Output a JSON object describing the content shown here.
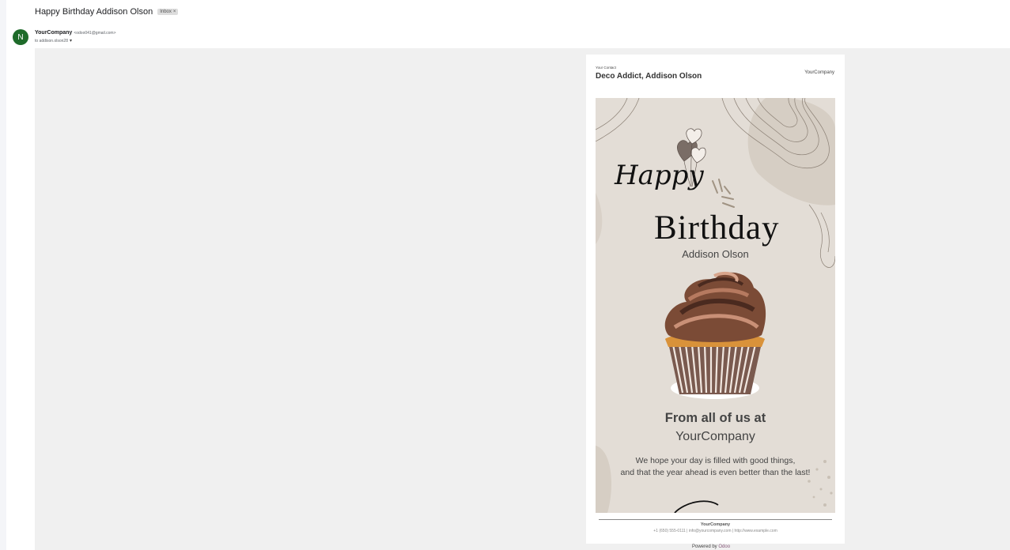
{
  "email": {
    "subject": "Happy Birthday Addison Olson",
    "label": "Inbox",
    "label_remove_glyph": "×",
    "sender_initial": "N",
    "sender_name": "YourCompany",
    "sender_email": "<odoo041@gmail.com>",
    "to_line": "to addison.olson28",
    "to_caret": "▾"
  },
  "card": {
    "contact_label": "Your Contact",
    "contact_name": "Deco Addict, Addison Olson",
    "company_right": "YourCompany",
    "banner": {
      "happy": "Happy",
      "birthday": "Birthday",
      "person": "Addison Olson",
      "from": "From all of us at",
      "company": "YourCompany",
      "wish_line1": "We hope your day is filled with good things,",
      "wish_line2": "and that the year ahead is even better than the last!"
    },
    "footer": {
      "company": "YourCompany",
      "contact": "+1 (650) 555-0111 | info@yourcompany.com | http://www.example.com"
    }
  },
  "powered": {
    "prefix": "Powered by",
    "brand": "Odoo"
  },
  "icons": [
    "avatar",
    "dropdown-caret-icon",
    "balloons-icon",
    "cupcake-image"
  ],
  "colors": {
    "avatar": "#1e6b2a",
    "banner_bg": "#e3ddd6",
    "mail_area_bg": "#f0f0f0",
    "odoo_brand": "#875a7b"
  }
}
